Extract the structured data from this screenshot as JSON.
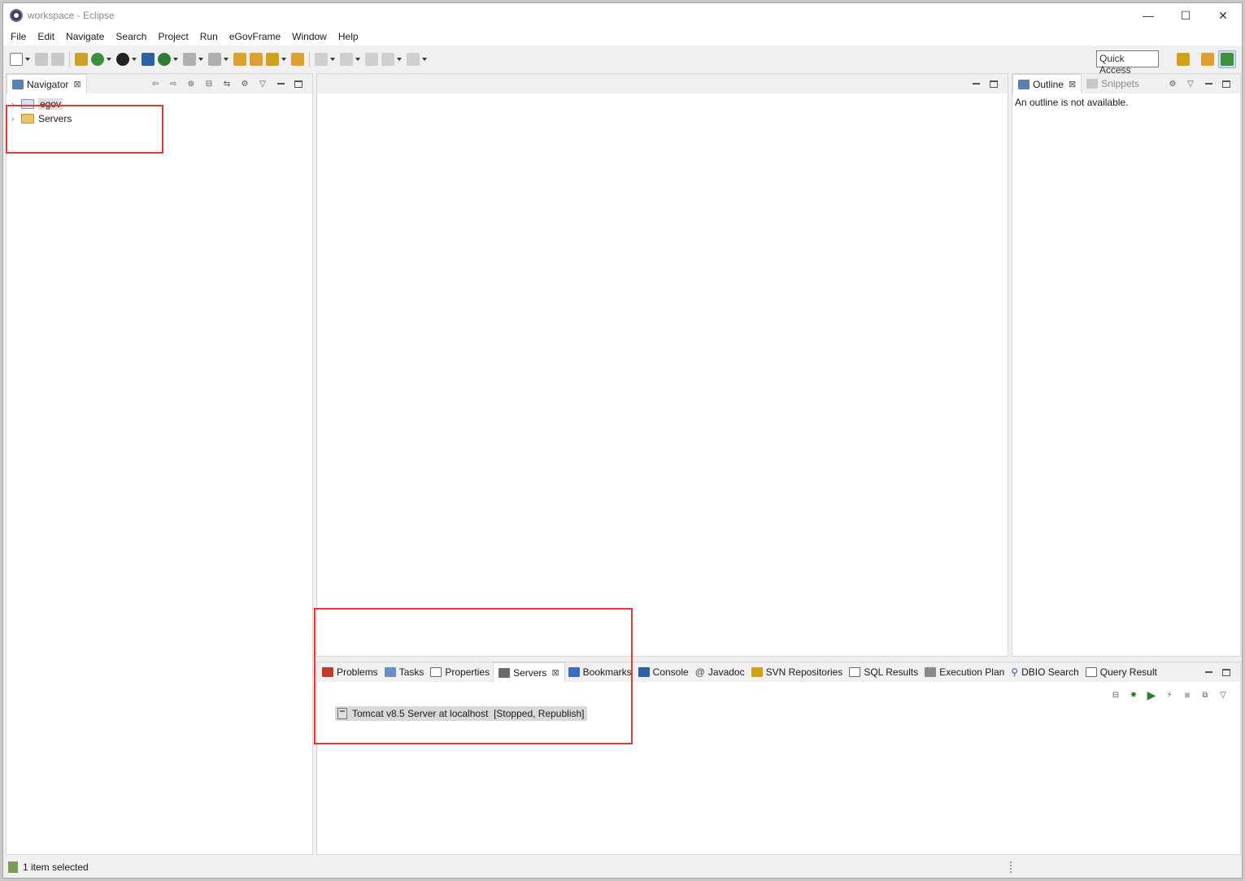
{
  "window": {
    "title": "workspace - Eclipse",
    "controls": {
      "minimize": "—",
      "maximize": "☐",
      "close": "✕"
    }
  },
  "menu": [
    "File",
    "Edit",
    "Navigate",
    "Search",
    "Project",
    "Run",
    "eGovFrame",
    "Window",
    "Help"
  ],
  "toolbar": {
    "quick_access": "Quick Access"
  },
  "navigator": {
    "tab_label": "Navigator",
    "items": [
      {
        "label": "egov",
        "icon": "project-icon"
      },
      {
        "label": "Servers",
        "icon": "folder-icon"
      }
    ]
  },
  "outline": {
    "tab_label": "Outline",
    "inactive_tab_label": "Snippets",
    "message": "An outline is not available."
  },
  "bottom_panel": {
    "tabs": [
      {
        "label": "Problems",
        "icon": "problems-icon"
      },
      {
        "label": "Tasks",
        "icon": "tasks-icon"
      },
      {
        "label": "Properties",
        "icon": "properties-icon"
      },
      {
        "label": "Servers",
        "icon": "servers-icon",
        "active": true
      },
      {
        "label": "Bookmarks",
        "icon": "bookmarks-icon"
      },
      {
        "label": "Console",
        "icon": "console-icon"
      },
      {
        "label": "Javadoc",
        "icon": "javadoc-icon"
      },
      {
        "label": "SVN Repositories",
        "icon": "svn-icon"
      },
      {
        "label": "SQL Results",
        "icon": "sql-results-icon"
      },
      {
        "label": "Execution Plan",
        "icon": "execution-plan-icon"
      },
      {
        "label": "DBIO Search",
        "icon": "search-icon"
      },
      {
        "label": "Query Result",
        "icon": "query-result-icon"
      }
    ],
    "server_entry": "Tomcat v8.5 Server at localhost  [Stopped, Republish]"
  },
  "status": {
    "text": "1 item selected"
  },
  "colors": {
    "highlight": "#e53935",
    "panel_bg": "#ffffff",
    "chrome_bg": "#f0f0f0"
  }
}
